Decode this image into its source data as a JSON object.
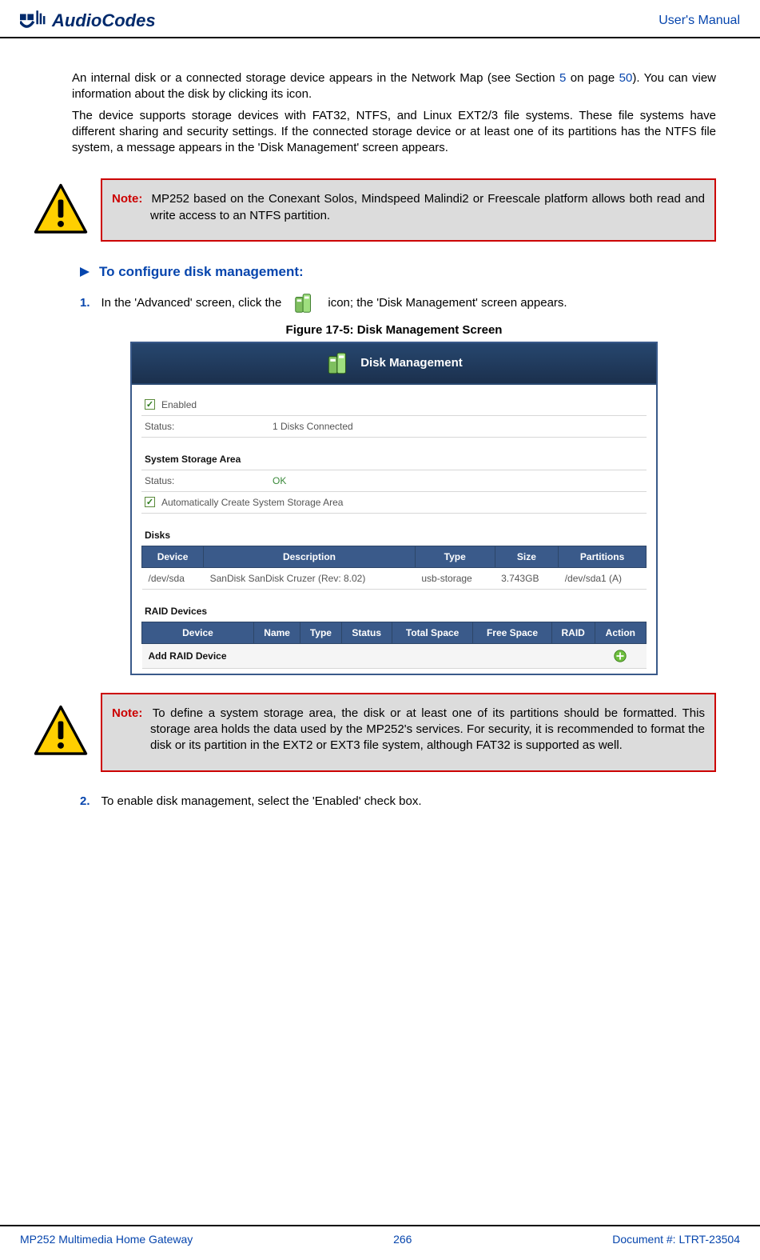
{
  "header": {
    "logo_text": "AudioCodes",
    "right_text": "User's Manual"
  },
  "body": {
    "para1_a": "An internal disk or a connected storage device appears in the Network Map (see Section ",
    "para1_link1": "5",
    "para1_b": " on page ",
    "para1_link2": "50",
    "para1_c": "). You can view information about the disk by clicking its icon.",
    "para2": "The device supports storage devices with FAT32, NTFS, and Linux EXT2/3 file systems. These file systems have different sharing and security settings. If the connected storage device or at least one of its partitions has the NTFS file system, a message appears in the 'Disk Management' screen appears.",
    "note1_label": "Note:",
    "note1_text": "MP252 based on the Conexant Solos, Mindspeed Malindi2 or Freescale platform allows both read and write access to an NTFS partition.",
    "step_heading": "To configure disk management:",
    "step1_num": "1.",
    "step1_a": "In the 'Advanced' screen, click the",
    "step1_b": "icon; the 'Disk Management' screen appears.",
    "figure_caption": "Figure 17-5: Disk Management Screen",
    "note2_label": "Note:",
    "note2_text": "To define a system storage area, the disk or at least one of its partitions should be formatted. This storage area holds the data used by the MP252's services. For security, it is recommended to format the disk or its partition in the EXT2 or EXT3 file system, although FAT32 is supported as well.",
    "step2_num": "2.",
    "step2_text": "To enable disk management, select the 'Enabled' check box."
  },
  "screenshot": {
    "title": "Disk Management",
    "enabled_label": "Enabled",
    "status_label": "Status:",
    "status_value": "1 Disks Connected",
    "section_storage": "System Storage Area",
    "storage_status_label": "Status:",
    "storage_status_value": "OK",
    "auto_create_label": "Automatically Create System Storage Area",
    "section_disks": "Disks",
    "disks_headers": {
      "device": "Device",
      "desc": "Description",
      "type": "Type",
      "size": "Size",
      "parts": "Partitions"
    },
    "disks_row": {
      "device": "/dev/sda",
      "desc": "SanDisk SanDisk Cruzer (Rev: 8.02)",
      "type": "usb-storage",
      "size": "3.743GB",
      "parts": "/dev/sda1 (A)"
    },
    "section_raid": "RAID Devices",
    "raid_headers": {
      "device": "Device",
      "name": "Name",
      "type": "Type",
      "status": "Status",
      "total": "Total Space",
      "free": "Free Space",
      "raid": "RAID",
      "action": "Action"
    },
    "raid_add_row": "Add RAID Device"
  },
  "footer": {
    "left": "MP252 Multimedia Home Gateway",
    "center": "266",
    "right": "Document #: LTRT-23504"
  }
}
